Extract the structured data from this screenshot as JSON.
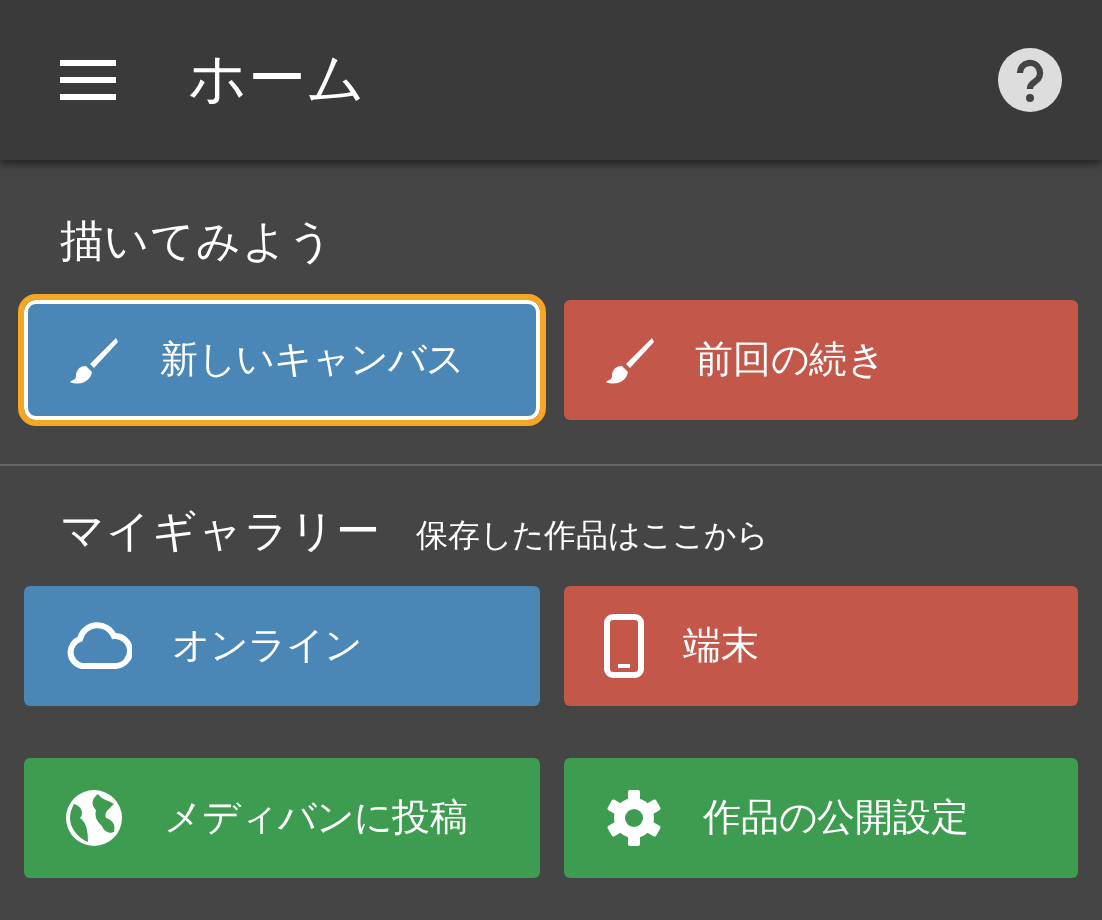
{
  "header": {
    "title": "ホーム"
  },
  "sections": [
    {
      "title": "描いてみよう",
      "buttons": [
        {
          "label": "新しいキャンバス",
          "color": "#4a87b6",
          "focused": true
        },
        {
          "label": "前回の続き",
          "color": "#c2574a",
          "focused": false
        }
      ]
    },
    {
      "title": "マイギャラリー",
      "subtitle": "保存した作品はここから",
      "buttons": [
        {
          "label": "オンライン",
          "color": "#4a87b6",
          "focused": false
        },
        {
          "label": "端末",
          "color": "#c2574a",
          "focused": false
        },
        {
          "label": "メディバンに投稿",
          "color": "#3d9c4f",
          "focused": false
        },
        {
          "label": "作品の公開設定",
          "color": "#3d9c4f",
          "focused": false
        }
      ]
    }
  ]
}
